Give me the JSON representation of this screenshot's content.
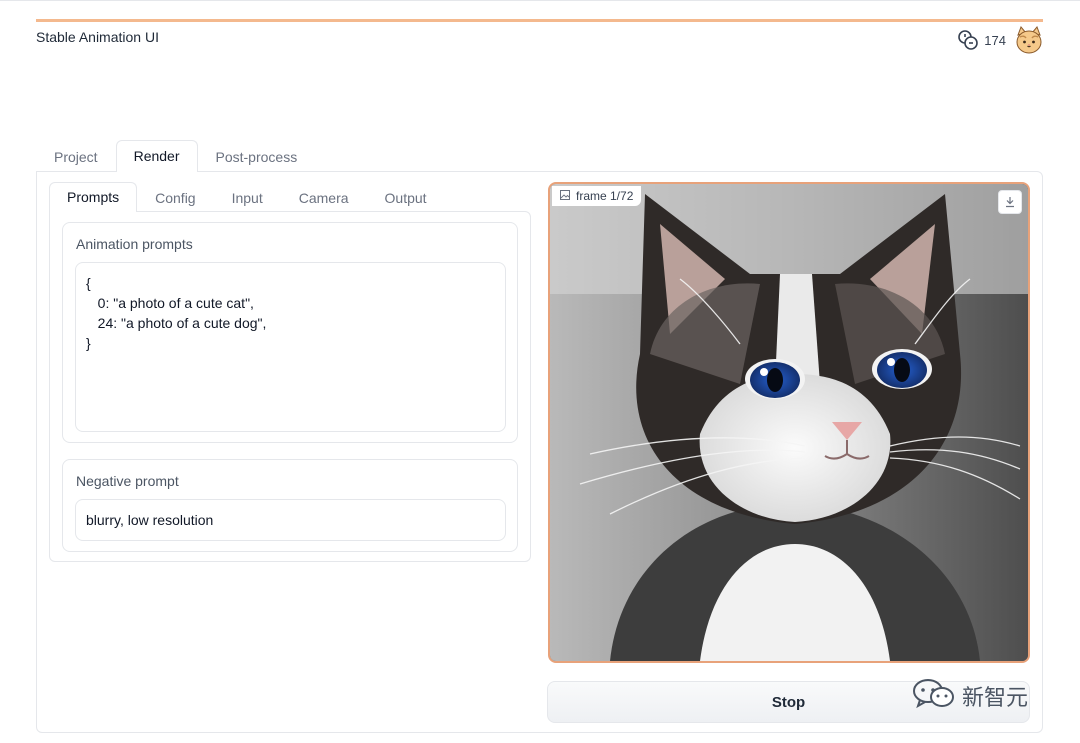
{
  "app": {
    "title": "Stable Animation UI",
    "visitor_count": "174"
  },
  "outer_tabs": [
    {
      "label": "Project",
      "active": false
    },
    {
      "label": "Render",
      "active": true
    },
    {
      "label": "Post-process",
      "active": false
    }
  ],
  "inner_tabs": [
    {
      "label": "Prompts",
      "active": true
    },
    {
      "label": "Config",
      "active": false
    },
    {
      "label": "Input",
      "active": false
    },
    {
      "label": "Camera",
      "active": false
    },
    {
      "label": "Output",
      "active": false
    }
  ],
  "animation_prompts": {
    "label": "Animation prompts",
    "value": "{\n   0: \"a photo of a cute cat\",\n   24: \"a photo of a cute dog\",\n}"
  },
  "negative_prompt": {
    "label": "Negative prompt",
    "value": "blurry, low resolution"
  },
  "output_image": {
    "frame_label": "frame 1/72"
  },
  "stop_button": {
    "label": "Stop"
  },
  "watermark": {
    "text": "新智元"
  },
  "colors": {
    "accent": "#f4b98e",
    "image_border": "#e8a27a"
  }
}
